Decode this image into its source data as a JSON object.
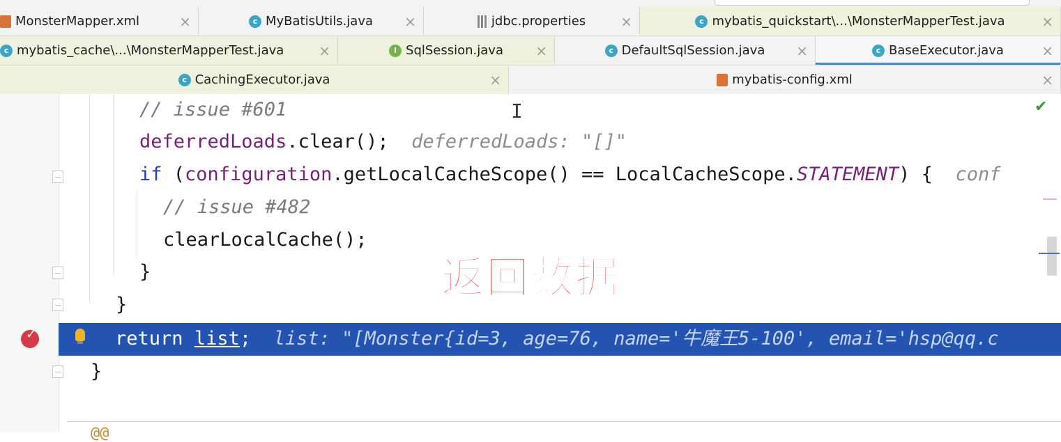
{
  "tabs_row1": [
    {
      "label": "MonsterMapper.xml",
      "icon": "xml-file-icon"
    },
    {
      "label": "MyBatisUtils.java",
      "icon": "class-icon"
    },
    {
      "label": "jdbc.properties",
      "icon": "properties-file-icon"
    },
    {
      "label": "mybatis_quickstart\\...\\MonsterMapperTest.java",
      "icon": "test-class-icon"
    }
  ],
  "tabs_row2": [
    {
      "label": "mybatis_cache\\...\\MonsterMapperTest.java",
      "icon": "test-class-icon"
    },
    {
      "label": "SqlSession.java",
      "icon": "interface-icon"
    },
    {
      "label": "DefaultSqlSession.java",
      "icon": "class-icon"
    },
    {
      "label": "BaseExecutor.java",
      "icon": "class-icon",
      "active": true
    }
  ],
  "tabs_row3": [
    {
      "label": "CachingExecutor.java",
      "icon": "class-icon"
    },
    {
      "label": "mybatis-config.xml",
      "icon": "xml-file-icon"
    }
  ],
  "code": {
    "line1": "// issue #601",
    "line2_code": "deferredLoads",
    "line2_call": ".clear();",
    "line2_hint": "deferredLoads: \"[]\"",
    "line3_kw": "if",
    "line3_open": " (",
    "line3_field": "configuration",
    "line3_mid": ".getLocalCacheScope() == LocalCacheScope.",
    "line3_static": "STATEMENT",
    "line3_close": ") {",
    "line3_hint": "conf",
    "line4": "// issue #482",
    "line5": "clearLocalCache();",
    "line6": "}",
    "line7": "}",
    "line8_kw": "return",
    "line8_var": "list",
    "line8_semicolon": ";",
    "line8_hint": "list: \"[Monster{id=3, age=76, name='牛魔王5-100', email='hsp@qq.c",
    "line9": "}",
    "next_line": "@@"
  },
  "overlay_text": "返回数据",
  "colors": {
    "selection": "#2354b1",
    "keyword": "#1e3dc8",
    "overlay": "#e8262a",
    "tab_active_underline": "#4a88c7"
  }
}
